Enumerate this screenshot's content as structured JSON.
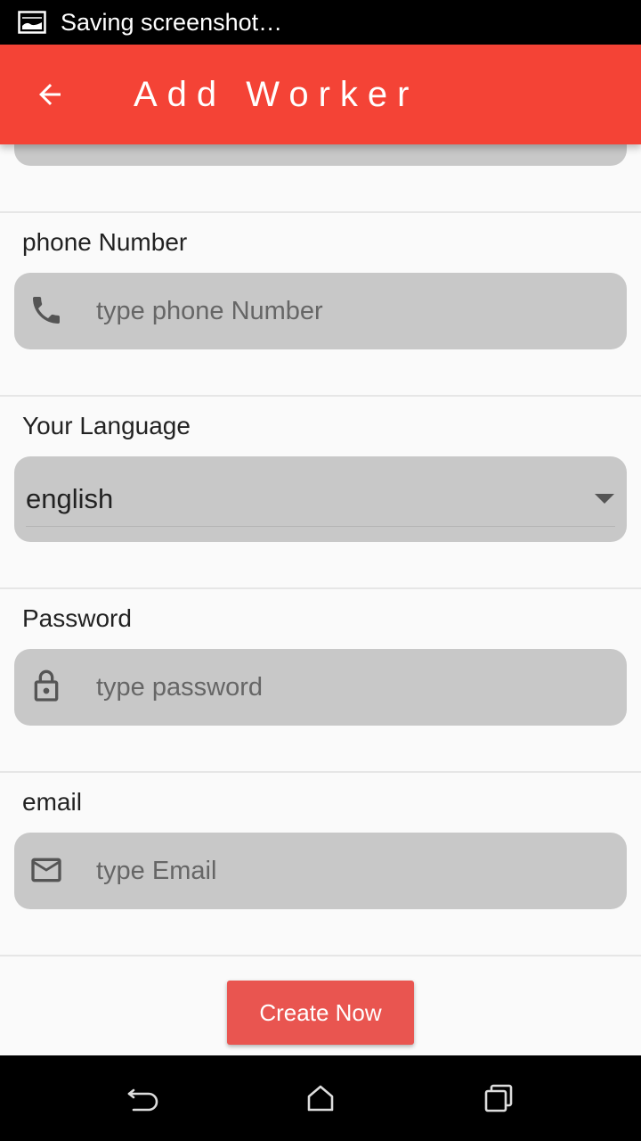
{
  "status_bar": {
    "text": "Saving screenshot…",
    "icon": "screenshot-icon"
  },
  "app_bar": {
    "title": "Add Worker",
    "back_icon": "arrow-back-icon",
    "color": "#f44336"
  },
  "form": {
    "phone": {
      "label": "phone Number",
      "placeholder": "type phone Number",
      "icon": "phone-icon"
    },
    "language": {
      "label": "Your Language",
      "value": "english",
      "icon": "dropdown-arrow-icon"
    },
    "password": {
      "label": "Password",
      "placeholder": "type password",
      "icon": "lock-icon"
    },
    "email": {
      "label": "email",
      "placeholder": "type Email",
      "icon": "mail-icon"
    },
    "submit_label": "Create Now",
    "submit_color": "#e95550"
  },
  "nav_bar": {
    "back": "nav-back-icon",
    "home": "nav-home-icon",
    "recents": "nav-recents-icon"
  }
}
